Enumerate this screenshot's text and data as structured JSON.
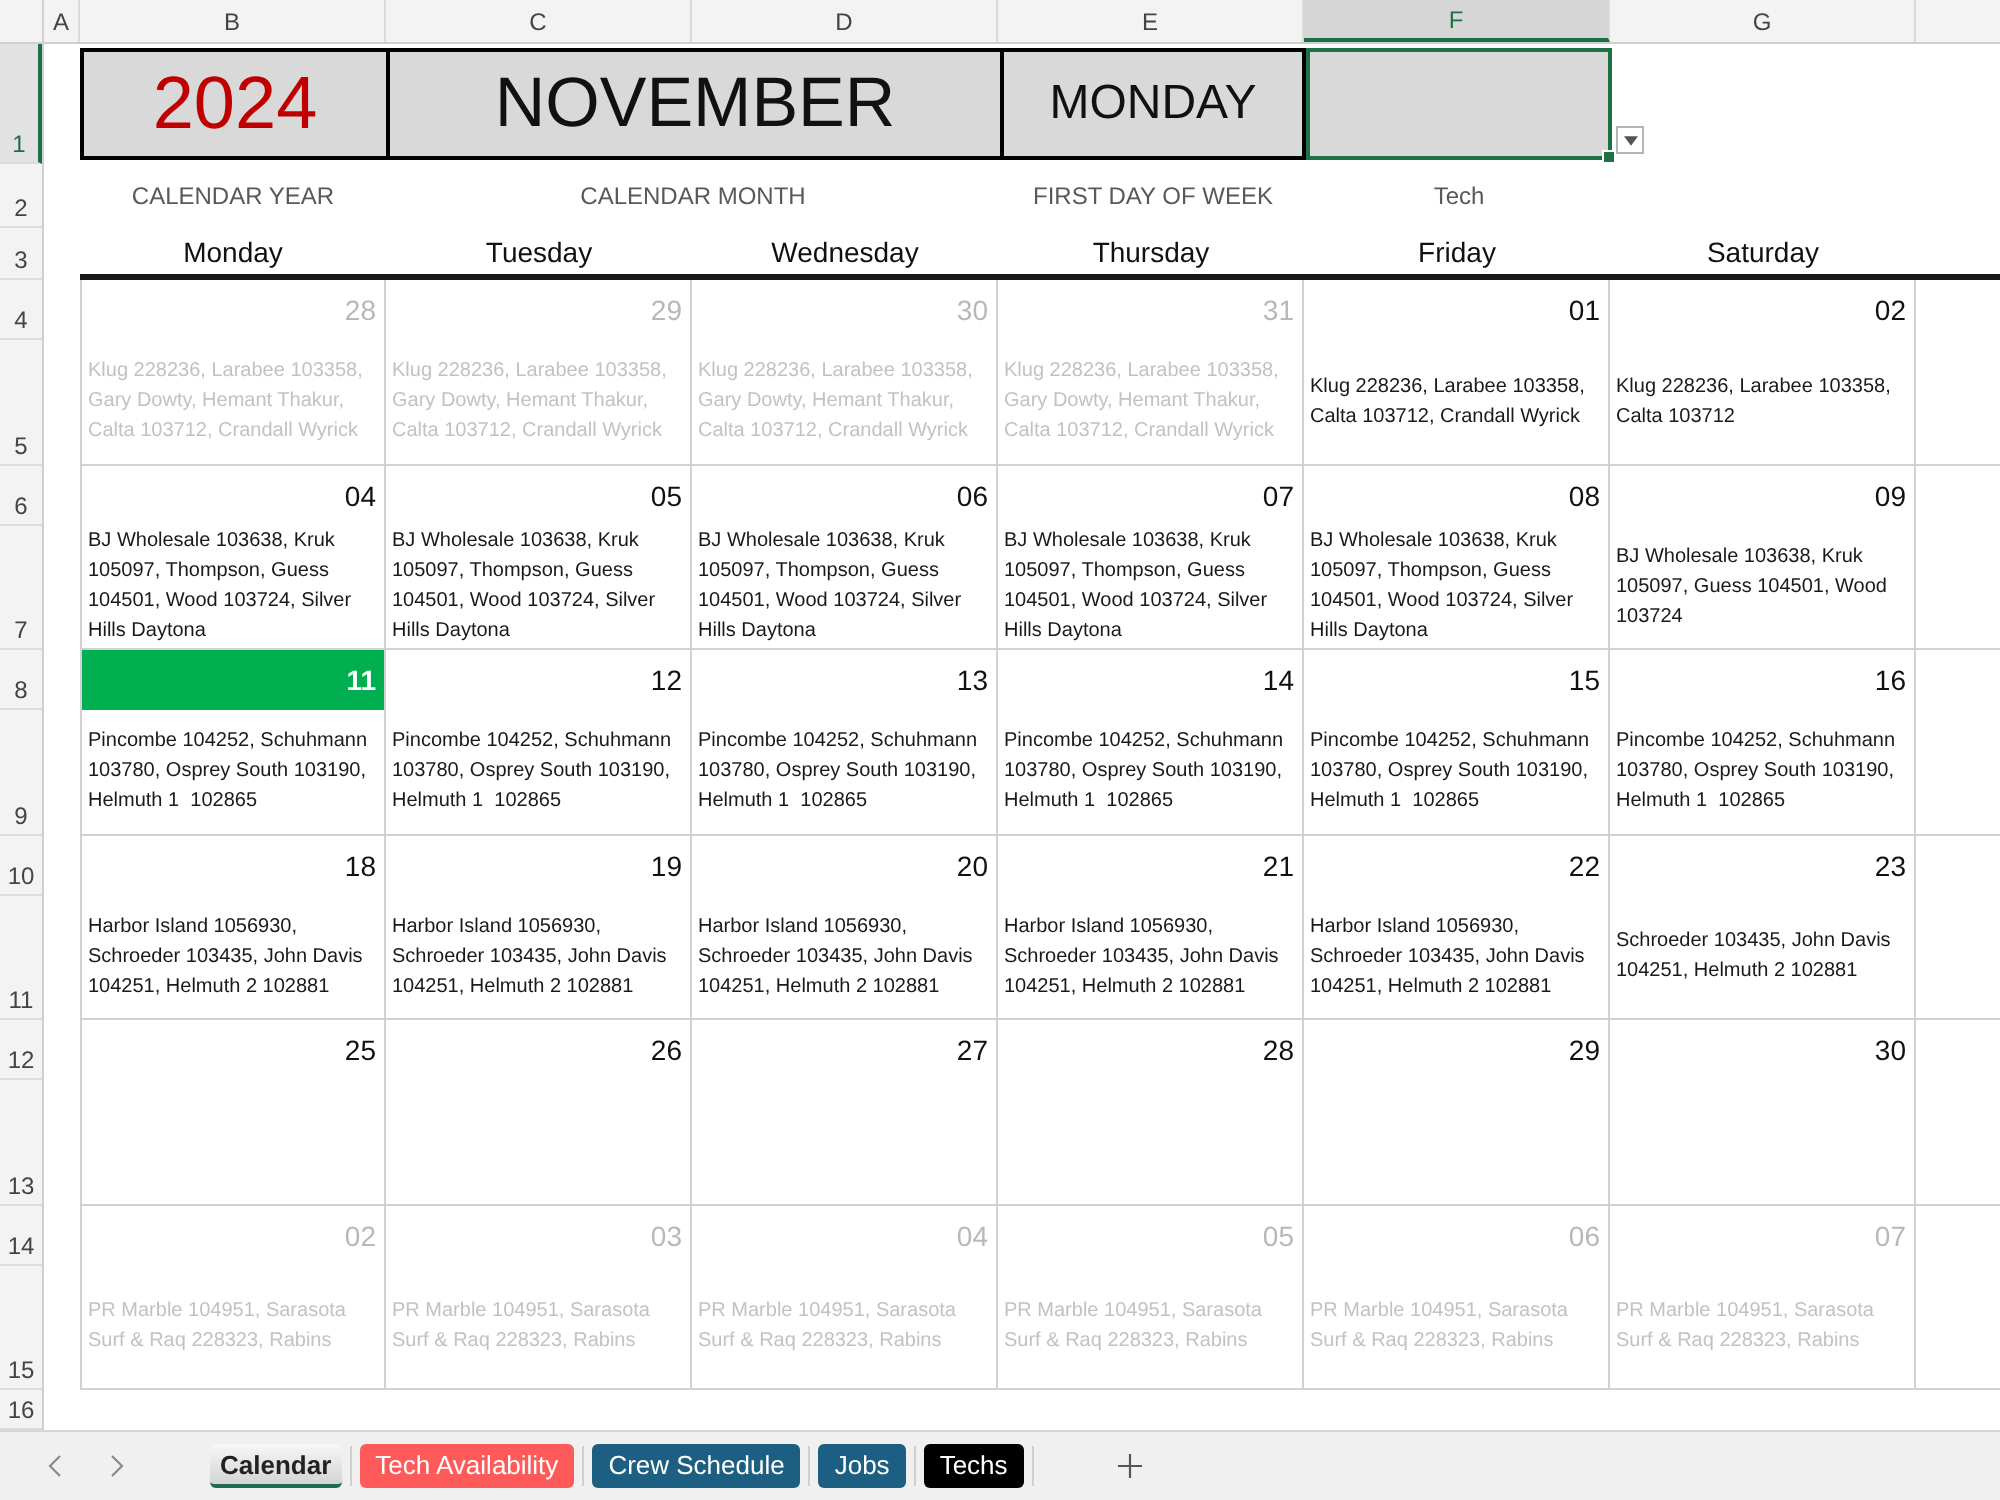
{
  "column_headers": [
    {
      "label": "A",
      "selected": false
    },
    {
      "label": "B",
      "selected": false
    },
    {
      "label": "C",
      "selected": false
    },
    {
      "label": "D",
      "selected": false
    },
    {
      "label": "E",
      "selected": false
    },
    {
      "label": "F",
      "selected": true
    },
    {
      "label": "G",
      "selected": false
    }
  ],
  "row_headers": [
    {
      "label": "1",
      "selected": true
    },
    {
      "label": "2",
      "selected": false
    },
    {
      "label": "3",
      "selected": false
    },
    {
      "label": "4",
      "selected": false
    },
    {
      "label": "5",
      "selected": false
    },
    {
      "label": "6",
      "selected": false
    },
    {
      "label": "7",
      "selected": false
    },
    {
      "label": "8",
      "selected": false
    },
    {
      "label": "9",
      "selected": false
    },
    {
      "label": "10",
      "selected": false
    },
    {
      "label": "11",
      "selected": false
    },
    {
      "label": "12",
      "selected": false
    },
    {
      "label": "13",
      "selected": false
    },
    {
      "label": "14",
      "selected": false
    },
    {
      "label": "15",
      "selected": false
    },
    {
      "label": "16",
      "selected": false
    }
  ],
  "header_cells": [
    {
      "kind": "year",
      "value": "2024",
      "label": "CALENDAR YEAR",
      "selected": false
    },
    {
      "kind": "month",
      "value": "NOVEMBER",
      "label": "CALENDAR MONTH",
      "selected": false
    },
    {
      "kind": "first_day",
      "value": "MONDAY",
      "label": "FIRST DAY OF WEEK",
      "selected": false
    },
    {
      "kind": "tech",
      "label": "Tech",
      "selected": true
    }
  ],
  "weekdays": [
    "Monday",
    "Tuesday",
    "Wednesday",
    "Thursday",
    "Friday",
    "Saturday"
  ],
  "weeks": [
    {
      "days": [
        {
          "date": "28",
          "in_month": false,
          "highlighted": false,
          "note": "Klug 228236, Larabee 103358, Gary Dowty, Hemant Thakur, Calta 103712, Crandall Wyrick"
        },
        {
          "date": "29",
          "in_month": false,
          "highlighted": false,
          "note": "Klug 228236, Larabee 103358, Gary Dowty, Hemant Thakur, Calta 103712, Crandall Wyrick"
        },
        {
          "date": "30",
          "in_month": false,
          "highlighted": false,
          "note": "Klug 228236, Larabee 103358, Gary Dowty, Hemant Thakur, Calta 103712, Crandall Wyrick"
        },
        {
          "date": "31",
          "in_month": false,
          "highlighted": false,
          "note": "Klug 228236, Larabee 103358, Gary Dowty, Hemant Thakur, Calta 103712, Crandall Wyrick"
        },
        {
          "date": "01",
          "in_month": true,
          "highlighted": false,
          "note": "Klug 228236, Larabee 103358, Calta 103712, Crandall Wyrick"
        },
        {
          "date": "02",
          "in_month": true,
          "highlighted": false,
          "note": "Klug 228236, Larabee 103358, Calta 103712"
        }
      ]
    },
    {
      "days": [
        {
          "date": "04",
          "in_month": true,
          "highlighted": false,
          "note": "BJ Wholesale 103638, Kruk 105097, Thompson, Guess 104501, Wood 103724, Silver Hills Daytona"
        },
        {
          "date": "05",
          "in_month": true,
          "highlighted": false,
          "note": "BJ Wholesale 103638, Kruk 105097, Thompson, Guess 104501, Wood 103724, Silver Hills Daytona"
        },
        {
          "date": "06",
          "in_month": true,
          "highlighted": false,
          "note": "BJ Wholesale 103638, Kruk 105097, Thompson, Guess 104501, Wood 103724, Silver Hills Daytona"
        },
        {
          "date": "07",
          "in_month": true,
          "highlighted": false,
          "note": "BJ Wholesale 103638, Kruk 105097, Thompson, Guess 104501, Wood 103724, Silver Hills Daytona"
        },
        {
          "date": "08",
          "in_month": true,
          "highlighted": false,
          "note": "BJ Wholesale 103638, Kruk 105097, Thompson, Guess 104501, Wood 103724, Silver Hills Daytona"
        },
        {
          "date": "09",
          "in_month": true,
          "highlighted": false,
          "note": "BJ Wholesale 103638, Kruk 105097, Guess 104501, Wood 103724"
        }
      ]
    },
    {
      "days": [
        {
          "date": "11",
          "in_month": true,
          "highlighted": true,
          "note": "Pincombe 104252, Schuhmann 103780, Osprey South 103190, Helmuth 1  102865"
        },
        {
          "date": "12",
          "in_month": true,
          "highlighted": false,
          "note": "Pincombe 104252, Schuhmann 103780, Osprey South 103190, Helmuth 1  102865"
        },
        {
          "date": "13",
          "in_month": true,
          "highlighted": false,
          "note": "Pincombe 104252, Schuhmann 103780, Osprey South 103190, Helmuth 1  102865"
        },
        {
          "date": "14",
          "in_month": true,
          "highlighted": false,
          "note": "Pincombe 104252, Schuhmann 103780, Osprey South 103190, Helmuth 1  102865"
        },
        {
          "date": "15",
          "in_month": true,
          "highlighted": false,
          "note": "Pincombe 104252, Schuhmann 103780, Osprey South 103190, Helmuth 1  102865"
        },
        {
          "date": "16",
          "in_month": true,
          "highlighted": false,
          "note": "Pincombe 104252, Schuhmann 103780, Osprey South 103190, Helmuth 1  102865"
        }
      ]
    },
    {
      "days": [
        {
          "date": "18",
          "in_month": true,
          "highlighted": false,
          "note": "Harbor Island 1056930, Schroeder 103435, John Davis 104251, Helmuth 2 102881"
        },
        {
          "date": "19",
          "in_month": true,
          "highlighted": false,
          "note": "Harbor Island 1056930, Schroeder 103435, John Davis 104251, Helmuth 2 102881"
        },
        {
          "date": "20",
          "in_month": true,
          "highlighted": false,
          "note": "Harbor Island 1056930, Schroeder 103435, John Davis 104251, Helmuth 2 102881"
        },
        {
          "date": "21",
          "in_month": true,
          "highlighted": false,
          "note": "Harbor Island 1056930, Schroeder 103435, John Davis 104251, Helmuth 2 102881"
        },
        {
          "date": "22",
          "in_month": true,
          "highlighted": false,
          "note": "Harbor Island 1056930, Schroeder 103435, John Davis 104251, Helmuth 2 102881"
        },
        {
          "date": "23",
          "in_month": true,
          "highlighted": false,
          "note": "Schroeder 103435, John Davis 104251, Helmuth 2 102881"
        }
      ]
    },
    {
      "days": [
        {
          "date": "25",
          "in_month": true,
          "highlighted": false
        },
        {
          "date": "26",
          "in_month": true,
          "highlighted": false
        },
        {
          "date": "27",
          "in_month": true,
          "highlighted": false
        },
        {
          "date": "28",
          "in_month": true,
          "highlighted": false
        },
        {
          "date": "29",
          "in_month": true,
          "highlighted": false
        },
        {
          "date": "30",
          "in_month": true,
          "highlighted": false
        }
      ]
    },
    {
      "days": [
        {
          "date": "02",
          "in_month": false,
          "highlighted": false,
          "note": "PR Marble 104951, Sarasota Surf & Raq 228323, Rabins"
        },
        {
          "date": "03",
          "in_month": false,
          "highlighted": false,
          "note": "PR Marble 104951, Sarasota Surf & Raq 228323, Rabins"
        },
        {
          "date": "04",
          "in_month": false,
          "highlighted": false,
          "note": "PR Marble 104951, Sarasota Surf & Raq 228323, Rabins"
        },
        {
          "date": "05",
          "in_month": false,
          "highlighted": false,
          "note": "PR Marble 104951, Sarasota Surf & Raq 228323, Rabins"
        },
        {
          "date": "06",
          "in_month": false,
          "highlighted": false,
          "note": "PR Marble 104951, Sarasota Surf & Raq 228323, Rabins"
        },
        {
          "date": "07",
          "in_month": false,
          "highlighted": false,
          "note": "PR Marble 104951, Sarasota Surf & Raq 228323, Rabins"
        }
      ]
    }
  ],
  "sheet_tabs": [
    {
      "label": "Calendar",
      "selected": true,
      "color": "#1f6b4f"
    },
    {
      "label": "Tech Availability",
      "selected": false,
      "color": "#ff5a5a"
    },
    {
      "label": "Crew Schedule",
      "selected": false,
      "color": "#1d5f82"
    },
    {
      "label": "Jobs",
      "selected": false,
      "color": "#1d5f82"
    },
    {
      "label": "Techs",
      "selected": false,
      "color": "#000000"
    }
  ]
}
